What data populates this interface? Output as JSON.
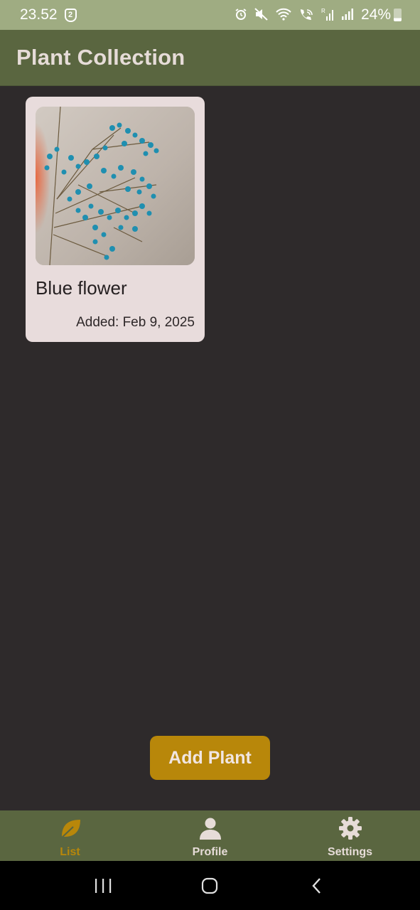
{
  "status_bar": {
    "time": "23.52",
    "notification_badge": "2",
    "battery_text": "24%",
    "icons": [
      "alarm-icon",
      "mute-icon",
      "wifi-icon",
      "wifi-calling-icon",
      "roaming-signal-icon",
      "signal-icon",
      "battery-icon"
    ]
  },
  "app_bar": {
    "title": "Plant Collection"
  },
  "plants": [
    {
      "name": "Blue flower",
      "added": "Added: Feb 9, 2025"
    }
  ],
  "actions": {
    "add_plant_label": "Add Plant"
  },
  "bottom_nav": {
    "items": [
      {
        "label": "List",
        "icon": "leaf-icon",
        "active": true
      },
      {
        "label": "Profile",
        "icon": "person-icon",
        "active": false
      },
      {
        "label": "Settings",
        "icon": "gear-icon",
        "active": false
      }
    ]
  },
  "colors": {
    "app_bar": "#5a6640",
    "status_bar": "#9fac82",
    "background": "#2e2a2b",
    "card": "#e8dcdc",
    "accent": "#b8870a",
    "nav_active": "#b8870a",
    "nav_inactive": "#e6dcd8"
  }
}
